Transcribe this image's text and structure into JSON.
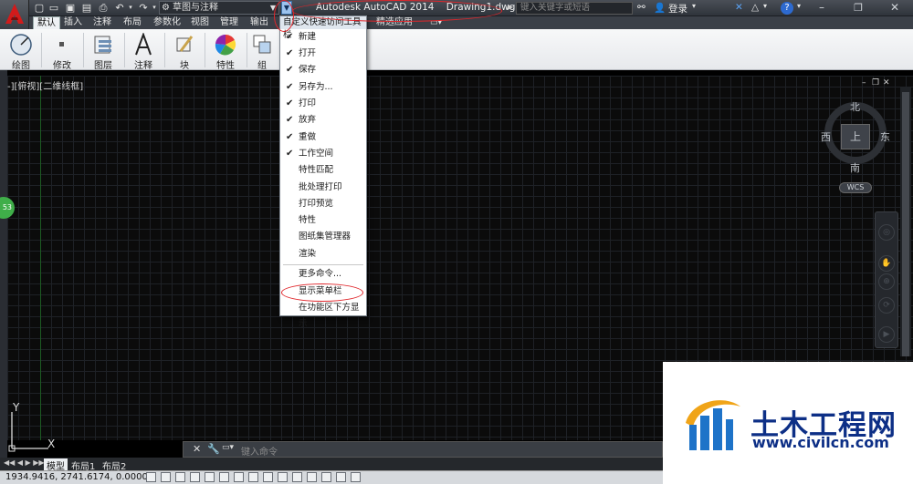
{
  "titlebar": {
    "workspace": "草图与注释",
    "app_title": "Autodesk AutoCAD 2014",
    "file_name": "Drawing1.dwg",
    "search_placeholder": "键入关键字或短语",
    "login": "登录"
  },
  "tabs": [
    "默认",
    "插入",
    "注释",
    "布局",
    "参数化",
    "视图",
    "管理",
    "输出",
    "精选应用"
  ],
  "ribbon": [
    "绘图",
    "修改",
    "图层",
    "注释",
    "块",
    "特性",
    "组"
  ],
  "quick_access_menu": {
    "title": "自定义快速访问工具栏",
    "checked_items": [
      "新建",
      "打开",
      "保存",
      "另存为...",
      "打印",
      "放弃",
      "重做",
      "工作空间"
    ],
    "unchecked_items": [
      "特性匹配",
      "批处理打印",
      "打印预览",
      "特性",
      "图纸集管理器",
      "渲染"
    ],
    "more_commands": "更多命令...",
    "show_menubar": "显示菜单栏",
    "below_ribbon": "在功能区下方显示"
  },
  "viewport": {
    "label": "-][俯视][二维线框]",
    "compass": {
      "north": "北",
      "south": "南",
      "east": "东",
      "west": "西",
      "top": "上"
    },
    "wcs": "WCS",
    "badge": "53"
  },
  "ucs": {
    "x": "X",
    "y": "Y"
  },
  "command": {
    "placeholder": "键入命令"
  },
  "layout_tabs": [
    "模型",
    "布局1",
    "布局2"
  ],
  "status": {
    "coords": "1934.9416, 2741.6174, 0.0000"
  },
  "watermark": {
    "title": "土木工程网",
    "url": "www.civilcn.com"
  },
  "colors": {
    "annotation": "#e0262b",
    "accent": "#9cc3ee",
    "watermark": "#0d2f86"
  }
}
